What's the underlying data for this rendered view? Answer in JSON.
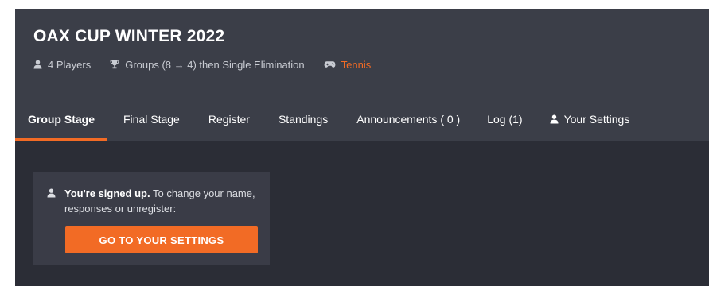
{
  "tournament": {
    "title": "OAX CUP WINTER 2022",
    "players": "4 Players",
    "format": "Groups (8 → 4) then Single Elimination",
    "sport": "Tennis",
    "icons": [
      "user-icon",
      "trophy-icon",
      "gamepad-icon"
    ]
  },
  "tabs": [
    {
      "label": "Group Stage",
      "active": true
    },
    {
      "label": "Final Stage",
      "active": false
    },
    {
      "label": "Register",
      "active": false
    },
    {
      "label": "Standings",
      "active": false
    },
    {
      "label": "Announcements ( 0 )",
      "active": false
    },
    {
      "label": "Log (1)",
      "active": false
    },
    {
      "label": "Your Settings",
      "active": false,
      "icon": "user-icon"
    }
  ],
  "signup_notice": {
    "icon": "user-icon",
    "bold": "You're signed up.",
    "text": " To change your name, responses or unregister:",
    "button_label": "GO TO YOUR SETTINGS"
  },
  "colors": {
    "accent": "#f26b25",
    "header_bg": "#3b3e48",
    "page_bg": "#2b2d36",
    "panel_bg": "#3a3c47"
  }
}
